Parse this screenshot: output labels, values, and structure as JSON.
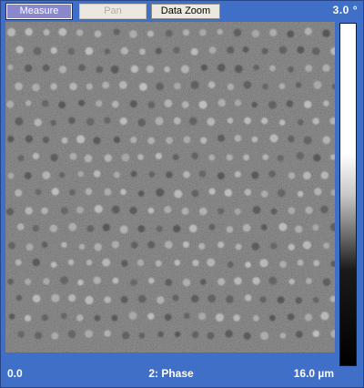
{
  "toolbar": {
    "measure_label": "Measure",
    "pan_label": "Pan",
    "data_zoom_label": "Data Zoom"
  },
  "colorbar": {
    "max_label": "3.0 °"
  },
  "footer": {
    "left_label": "0.0",
    "channel_label": "2: Phase",
    "right_label": "16.0 µm"
  },
  "colors": {
    "background": "#3f6fc7",
    "active_tool": "#8a87cc"
  }
}
